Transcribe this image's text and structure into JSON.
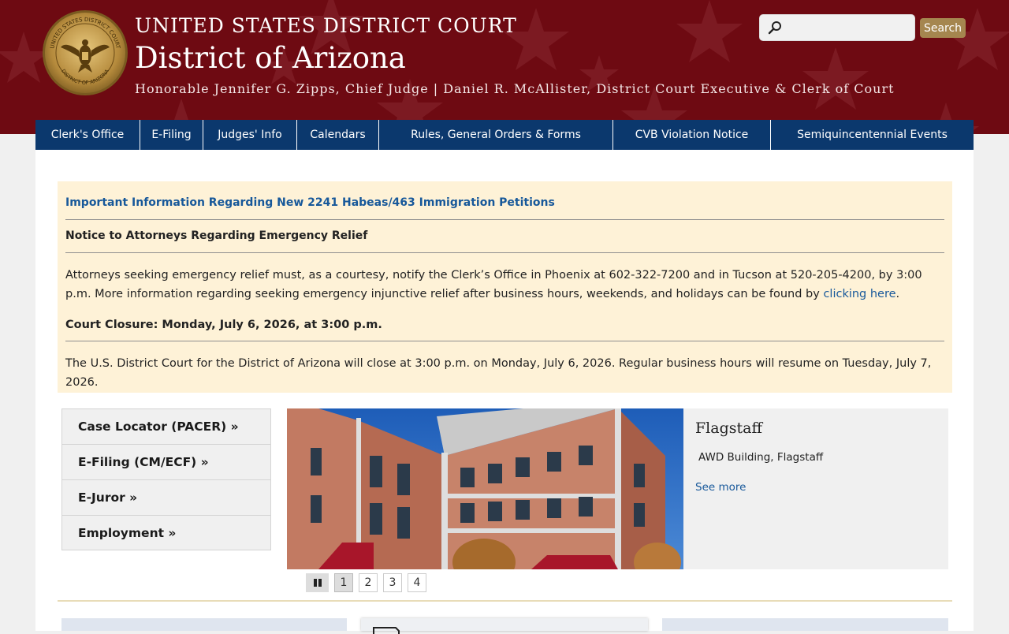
{
  "header": {
    "court_name": "UNITED STATES DISTRICT COURT",
    "district": "District of Arizona",
    "judges_line": "Honorable Jennifer G. Zipps, Chief Judge | Daniel R. McAllister, District Court Executive & Clerk of Court",
    "seal_top_text": "UNITED STATES DISTRICT COURT",
    "seal_bottom_text": "DISTRICT OF ARIZONA"
  },
  "search": {
    "placeholder": "",
    "button_label": "Search",
    "icon": "magnifier-icon"
  },
  "nav": [
    "Clerk's Office",
    "E-Filing",
    "Judges' Info",
    "Calendars",
    "Rules, General Orders & Forms",
    "CVB Violation Notice",
    "Semiquincentennial Events"
  ],
  "notice": {
    "link_text": "Important Information Regarding New 2241 Habeas/463 Immigration Petitions",
    "heading1": "Notice to Attorneys Regarding Emergency Relief",
    "para1": "Attorneys seeking emergency relief must, as a courtesy, notify the Clerk’s Office in Phoenix at 602-322-7200 and in Tucson at 520-205-4200, by 3:00 p.m. More information regarding seeking emergency injunctive relief after business hours, weekends, and holidays can be found by",
    "para1_link": "clicking here",
    "para1_end": ".",
    "heading2": "Court Closure: Monday, July 6, 2026, at 3:00 p.m.",
    "para2": "The U.S. District Court for the District of Arizona will close at 3:00 p.m. on Monday, July 6, 2026. Regular business hours will resume on Tuesday, July 7, 2026."
  },
  "quick_links": [
    "Case Locator (PACER) »",
    "E-Filing (CM/ECF) »",
    "E-Juror »",
    "Employment »"
  ],
  "slideshow": {
    "title": "Flagstaff",
    "description": "AWD Building, Flagstaff",
    "more_link": "See more",
    "pages": [
      "1",
      "2",
      "3",
      "4"
    ],
    "active_page": 1,
    "pause_icon": "pause-icon"
  },
  "colors": {
    "header_bg": "#6e0a12",
    "nav_bg": "#0b386d",
    "notice_bg": "#fef2d7",
    "link": "#17589a",
    "search_button": "#a5864f"
  }
}
